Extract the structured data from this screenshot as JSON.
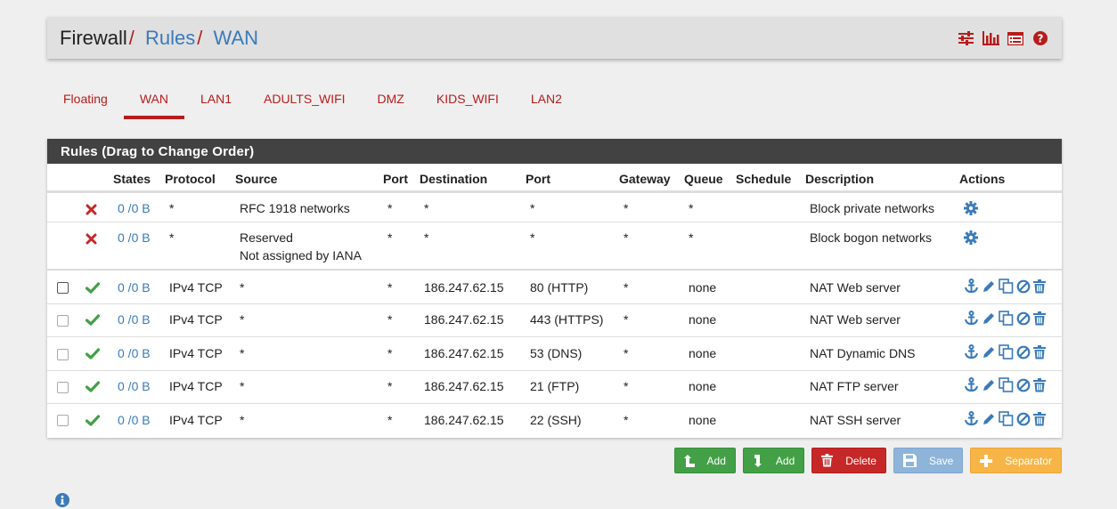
{
  "breadcrumb": {
    "root": "Firewall",
    "sep": "/",
    "level1": "Rules",
    "level2": "WAN"
  },
  "header_icons": [
    "sliders-icon",
    "chart-icon",
    "list-icon",
    "help-icon"
  ],
  "tabs": [
    {
      "label": "Floating",
      "active": false
    },
    {
      "label": "WAN",
      "active": true
    },
    {
      "label": "LAN1",
      "active": false
    },
    {
      "label": "ADULTS_WIFI",
      "active": false
    },
    {
      "label": "DMZ",
      "active": false
    },
    {
      "label": "KIDS_WIFI",
      "active": false
    },
    {
      "label": "LAN2",
      "active": false
    }
  ],
  "panel": {
    "title": "Rules (Drag to Change Order)"
  },
  "columns": {
    "states": "States",
    "protocol": "Protocol",
    "source": "Source",
    "source_port": "Port",
    "destination": "Destination",
    "dest_port": "Port",
    "gateway": "Gateway",
    "queue": "Queue",
    "schedule": "Schedule",
    "description": "Description",
    "actions": "Actions"
  },
  "rows": [
    {
      "status": "block",
      "states": "0 /0 B",
      "protocol": "*",
      "source": "RFC 1918 networks",
      "source2": "",
      "sport": "*",
      "destination": "*",
      "dport": "*",
      "gateway": "*",
      "queue": "*",
      "schedule": "",
      "description": "Block private networks"
    },
    {
      "status": "block",
      "states": "0 /0 B",
      "protocol": "*",
      "source": "Reserved",
      "source2": "Not assigned by IANA",
      "sport": "*",
      "destination": "*",
      "dport": "*",
      "gateway": "*",
      "queue": "*",
      "schedule": "",
      "description": "Block bogon networks"
    },
    {
      "status": "pass",
      "states": "0 /0 B",
      "protocol": "IPv4 TCP",
      "source": "*",
      "source2": "",
      "sport": "*",
      "destination": "186.247.62.15",
      "dport": "80 (HTTP)",
      "gateway": "*",
      "queue": "none",
      "schedule": "",
      "description": "NAT Web server"
    },
    {
      "status": "pass",
      "states": "0 /0 B",
      "protocol": "IPv4 TCP",
      "source": "*",
      "source2": "",
      "sport": "*",
      "destination": "186.247.62.15",
      "dport": "443 (HTTPS)",
      "gateway": "*",
      "queue": "none",
      "schedule": "",
      "description": "NAT Web server"
    },
    {
      "status": "pass",
      "states": "0 /0 B",
      "protocol": "IPv4 TCP",
      "source": "*",
      "source2": "",
      "sport": "*",
      "destination": "186.247.62.15",
      "dport": "53 (DNS)",
      "gateway": "*",
      "queue": "none",
      "schedule": "",
      "description": "NAT Dynamic DNS"
    },
    {
      "status": "pass",
      "states": "0 /0 B",
      "protocol": "IPv4 TCP",
      "source": "*",
      "source2": "",
      "sport": "*",
      "destination": "186.247.62.15",
      "dport": "21 (FTP)",
      "gateway": "*",
      "queue": "none",
      "schedule": "",
      "description": "NAT FTP server"
    },
    {
      "status": "pass",
      "states": "0 /0 B",
      "protocol": "IPv4 TCP",
      "source": "*",
      "source2": "",
      "sport": "*",
      "destination": "186.247.62.15",
      "dport": "22 (SSH)",
      "gateway": "*",
      "queue": "none",
      "schedule": "",
      "description": "NAT SSH server"
    }
  ],
  "buttons": {
    "add_top": "Add",
    "add_bottom": "Add",
    "delete": "Delete",
    "save": "Save",
    "separator": "Separator"
  },
  "colors": {
    "accent_red": "#b71c1c",
    "link_blue": "#3a7ab8",
    "pass_green": "#43a047",
    "heading_dark": "#424242"
  }
}
